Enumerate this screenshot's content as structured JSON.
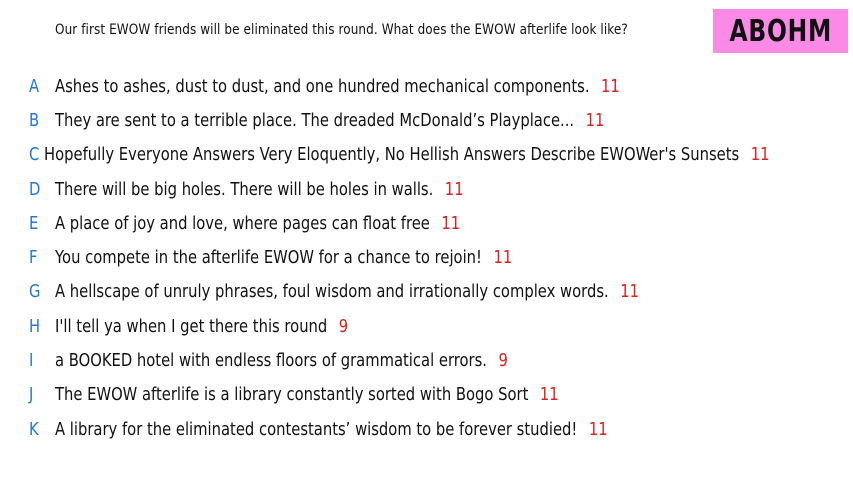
{
  "header": {
    "prompt": "Our first EWOW friends will be eliminated this round. What does the EWOW afterlife look like?",
    "badge_label": "ABOHM",
    "badge_color": "#fb8ae7"
  },
  "colors": {
    "letter": "#2277d6",
    "count": "#e0201e",
    "text": "#111111"
  },
  "responses": [
    {
      "letter": "A",
      "text": "Ashes to ashes, dust to dust, and one hundred mechanical components.",
      "count": "11"
    },
    {
      "letter": "B",
      "text": "They are sent to a terrible place. The dreaded McDonald’s Playplace...",
      "count": "11"
    },
    {
      "letter": "C",
      "text": "Hopefully Everyone Answers Very Eloquently, No Hellish Answers Describe EWOWer's Sunsets",
      "count": "11"
    },
    {
      "letter": "D",
      "text": "There will be big holes. There will be holes in walls.",
      "count": "11"
    },
    {
      "letter": "E",
      "text": "A place of joy and love, where pages can float free",
      "count": "11"
    },
    {
      "letter": "F",
      "text": "You compete in the afterlife EWOW for a chance to rejoin!",
      "count": "11"
    },
    {
      "letter": "G",
      "text": "A hellscape of unruly phrases, foul wisdom and irrationally complex words.",
      "count": "11"
    },
    {
      "letter": "H",
      "text": "I'll tell ya when I get there this round",
      "count": "9"
    },
    {
      "letter": "I",
      "text": "a BOOKED hotel with endless floors of grammatical errors.",
      "count": "9"
    },
    {
      "letter": "J",
      "text": "The EWOW afterlife is a library constantly sorted with Bogo Sort",
      "count": "11"
    },
    {
      "letter": "K",
      "text": "A library for the eliminated contestants’ wisdom to be forever studied!",
      "count": "11"
    }
  ]
}
